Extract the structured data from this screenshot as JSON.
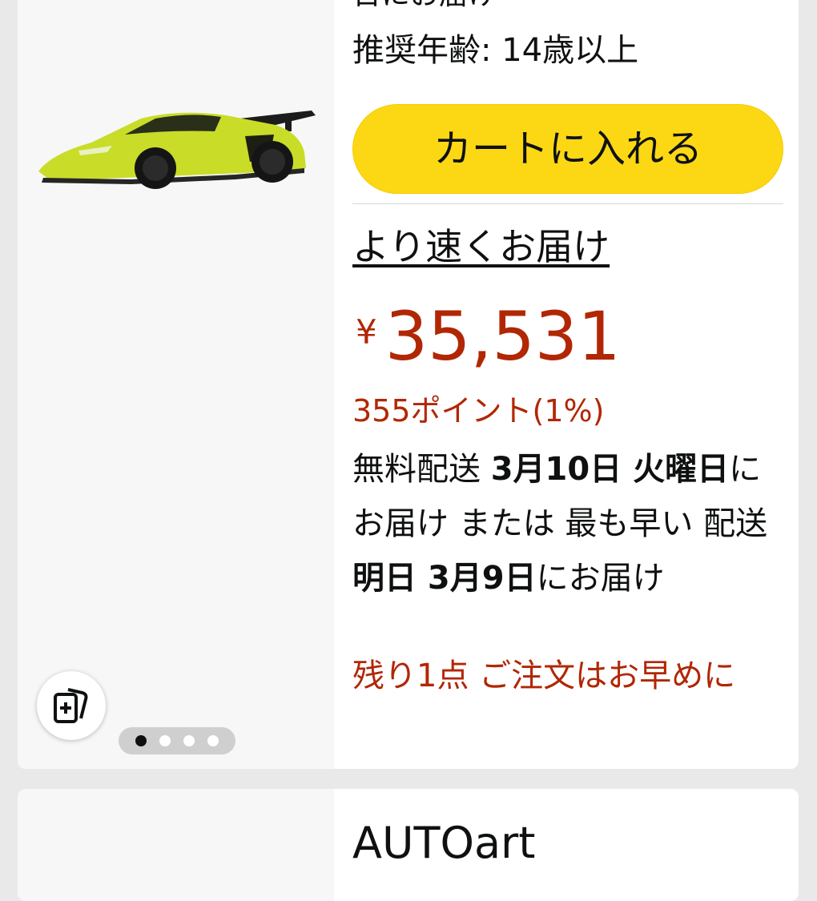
{
  "product": {
    "truncated_line": "日にお届け",
    "age_label": "推奨年齢: 14歳以上",
    "add_to_cart": "カートに入れる",
    "faster_delivery": "より速くお届け",
    "currency": "¥",
    "price": "35,531",
    "points": "355ポイント(1%)",
    "delivery": {
      "free_label": "無料配送",
      "free_date": "3月10日 火曜日",
      "free_suffix": "にお届け",
      "or_label": "または 最も早い 配送",
      "fast_date": "明日 3月9日",
      "fast_suffix": "にお届け"
    },
    "stock": "残り1点 ご注文はお早めに",
    "carousel": {
      "count": 4,
      "active_index": 0
    },
    "image_name": "yellow-sports-car-model"
  },
  "next_product": {
    "brand": "AUTOart"
  },
  "colors": {
    "price_red": "#b12704",
    "cart_yellow": "#fcd814",
    "text": "#0f1111"
  },
  "icons": {
    "compare": "compare-cards-icon"
  }
}
